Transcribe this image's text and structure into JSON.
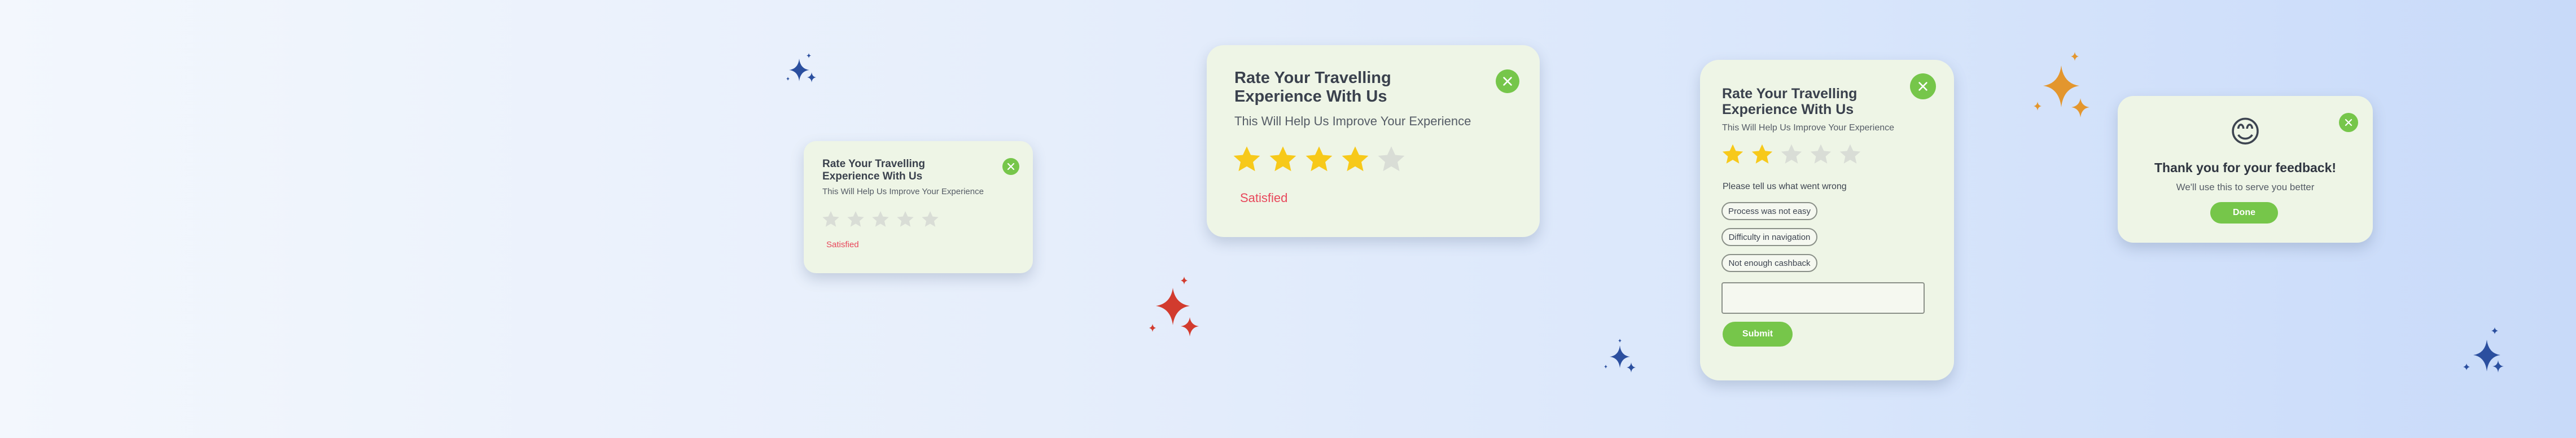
{
  "colors": {
    "accent_green": "#76c64a",
    "star_filled": "#f7c91a",
    "star_empty": "#d9ddd6",
    "status_red": "#e8475b",
    "sparkle_blue": "#2b4f9f",
    "sparkle_red": "#d23b2e",
    "sparkle_orange": "#e3962e"
  },
  "card_small": {
    "title_line1": "Rate Your Travelling",
    "title_line2": "Experience With Us",
    "subtitle": "This Will Help Us Improve Your Experience",
    "rating": 0,
    "max_rating": 5,
    "status": "Satisfied",
    "close_icon": "close-icon"
  },
  "card_large": {
    "title_line1": "Rate Your Travelling",
    "title_line2": "Experience With Us",
    "subtitle": "This Will Help Us Improve Your Experience",
    "rating": 4,
    "max_rating": 5,
    "status": "Satisfied",
    "close_icon": "close-icon"
  },
  "card_feedback": {
    "title_line1": "Rate Your Travelling",
    "title_line2": "Experience With Us",
    "subtitle": "This Will Help Us Improve Your Experience",
    "rating": 2,
    "max_rating": 5,
    "prompt": "Please tell us what went wrong",
    "options": [
      "Process was not easy",
      "Difficulty in navigation",
      "Not enough cashback"
    ],
    "comment_value": "",
    "submit_label": "Submit",
    "close_icon": "close-icon"
  },
  "card_thanks": {
    "emoji": "😊",
    "title": "Thank you for your feedback!",
    "message": "We'll use this to serve you better",
    "done_label": "Done",
    "close_icon": "close-icon"
  }
}
